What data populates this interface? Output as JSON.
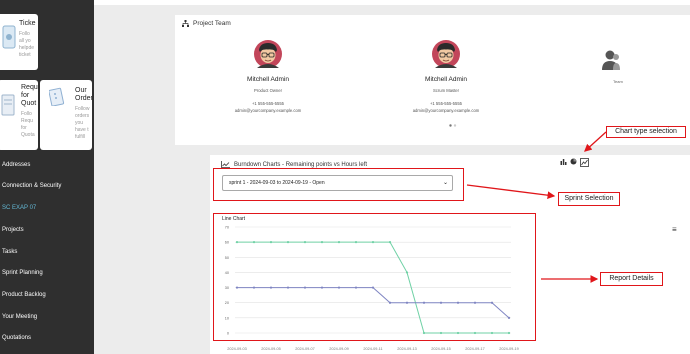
{
  "sidebar": {
    "cards": {
      "tickets": {
        "title": "Ticke",
        "desc": [
          "Follo",
          "all yo",
          "helpde",
          "ticket"
        ]
      },
      "quotation": {
        "title": [
          "Requ",
          "for",
          "Quot"
        ],
        "desc": [
          "Follo",
          "Requ",
          "for",
          "Quota"
        ]
      },
      "orders": {
        "title": [
          "Our",
          "Orders"
        ],
        "desc": [
          "Follow",
          "orders",
          "you",
          "have t",
          "fulfill"
        ]
      }
    },
    "nav": [
      {
        "label": "Addresses"
      },
      {
        "label": "Connection & Security"
      },
      {
        "label": "SC EXAP 07"
      },
      {
        "label": "Projects"
      },
      {
        "label": "Tasks"
      },
      {
        "label": "Sprint Planning"
      },
      {
        "label": "Product Backlog"
      },
      {
        "label": "Your Meeting"
      },
      {
        "label": "Quotations"
      }
    ],
    "active_color": "#64b9d6"
  },
  "team": {
    "title": "Project Team",
    "members": [
      {
        "name": "Mitchell Admin",
        "role": "Product Owner",
        "phone": "+1 555-555-5555",
        "email": "admin@yourcompany.example.com"
      },
      {
        "name": "Mitchell Admin",
        "role": "Scrum Master",
        "phone": "+1 555-555-5555",
        "email": "admin@yourcompany.example.com"
      }
    ],
    "team_label": "Team"
  },
  "burndown": {
    "title": "Burndown Charts - Remaining points vs Hours left",
    "sprint_selected": "sprint 1 - 2024-09-03 to 2024-09-19 - Open",
    "chart_types": [
      "bar-chart-icon",
      "pie-chart-icon",
      "line-chart-icon"
    ]
  },
  "annotations": {
    "chart_type": "Chart type selection",
    "sprint": "Sprint Selection",
    "report": "Report Details"
  },
  "chart_data": {
    "type": "line",
    "title": "Line Chart",
    "x": [
      "2024-09-03",
      "2024-09-04",
      "2024-09-05",
      "2024-09-06",
      "2024-09-07",
      "2024-09-08",
      "2024-09-09",
      "2024-09-10",
      "2024-09-11",
      "2024-09-12",
      "2024-09-13",
      "2024-09-14",
      "2024-09-15",
      "2024-09-16",
      "2024-09-17",
      "2024-09-18",
      "2024-09-19"
    ],
    "x_tick_labels": [
      "2024-09-03",
      "2024-09-05",
      "2024-09-07",
      "2024-09-09",
      "2024-09-11",
      "2024-09-13",
      "2024-09-15",
      "2024-09-17",
      "2024-09-19"
    ],
    "series": [
      {
        "values": [
          60,
          60,
          60,
          60,
          60,
          60,
          60,
          60,
          60,
          60,
          40,
          0,
          0,
          0,
          0,
          0,
          0
        ],
        "color": "#6fd1a5"
      },
      {
        "values": [
          30,
          30,
          30,
          30,
          30,
          30,
          30,
          30,
          30,
          20,
          20,
          20,
          20,
          20,
          20,
          20,
          10
        ],
        "color": "#7f85c2"
      }
    ],
    "ylim": [
      0,
      70
    ],
    "yticks": [
      0,
      10,
      20,
      30,
      40,
      50,
      60,
      70
    ],
    "grid": true
  }
}
